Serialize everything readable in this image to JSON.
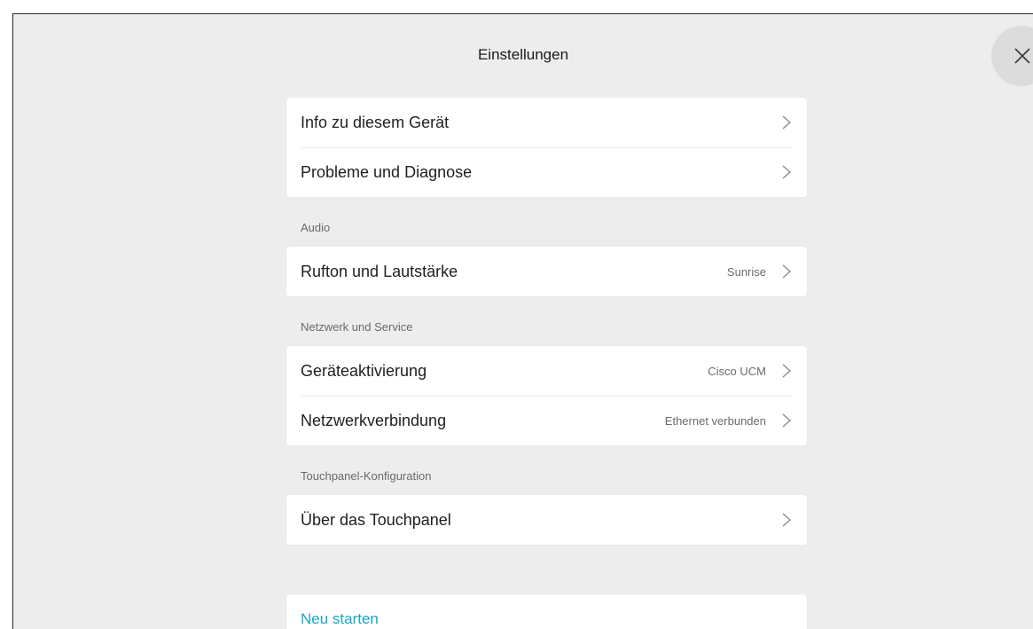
{
  "header": {
    "title": "Einstellungen",
    "close_icon": "close-icon"
  },
  "groups": {
    "general": {
      "items": [
        {
          "label": "Info zu diesem Gerät",
          "value": ""
        },
        {
          "label": "Probleme und Diagnose",
          "value": ""
        }
      ]
    },
    "audio": {
      "heading": "Audio",
      "items": [
        {
          "label": "Rufton und Lautstärke",
          "value": "Sunrise"
        }
      ]
    },
    "network": {
      "heading": "Netzwerk und Service",
      "items": [
        {
          "label": "Geräteaktivierung",
          "value": "Cisco UCM"
        },
        {
          "label": "Netzwerkverbindung",
          "value": "Ethernet verbunden"
        }
      ]
    },
    "touchpanel": {
      "heading": "Touchpanel-Konfiguration",
      "items": [
        {
          "label": "Über das Touchpanel",
          "value": ""
        }
      ]
    }
  },
  "actions": {
    "restart_label": "Neu starten"
  },
  "colors": {
    "background": "#ededed",
    "card": "#ffffff",
    "accent": "#17a7c8"
  }
}
